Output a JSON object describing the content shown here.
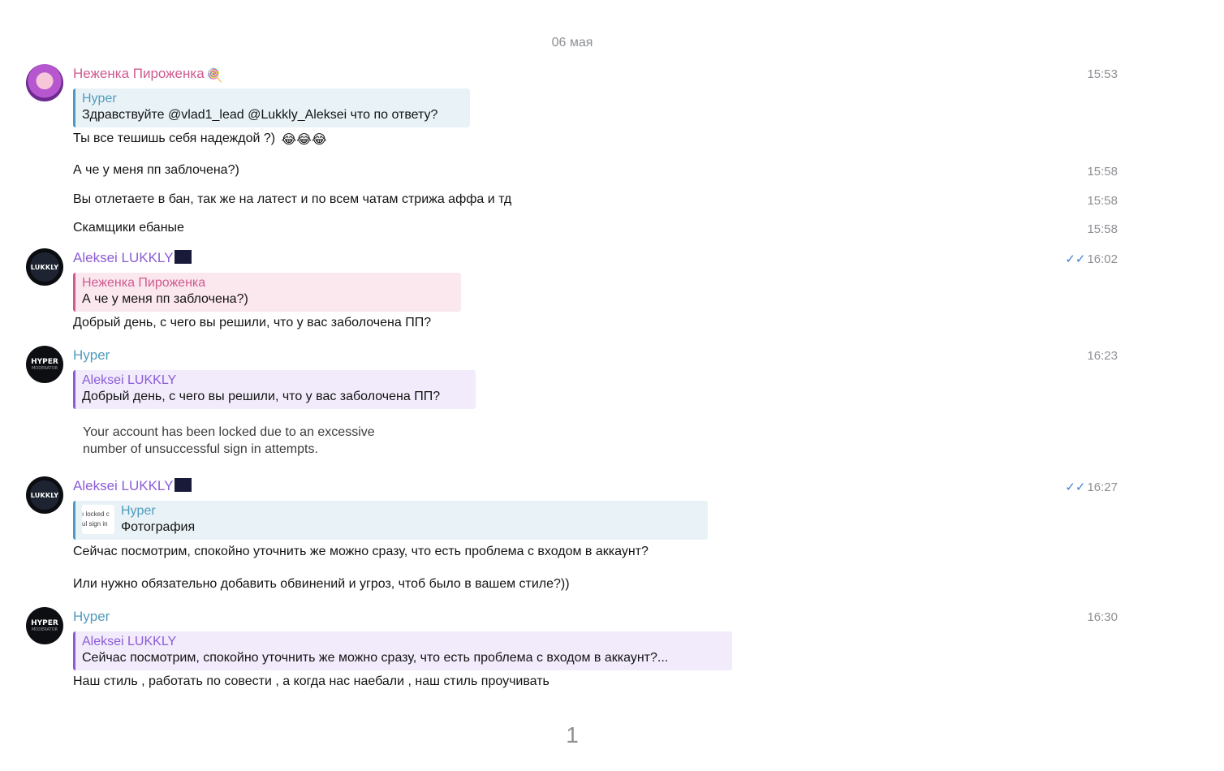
{
  "date_separator": "06 мая",
  "page_number": "1",
  "colors": {
    "sender_pink": "#cf5a8f",
    "sender_purple": "#8b5cd6",
    "sender_blue": "#4f9bbd",
    "read_ticks": "#3f7fd6"
  },
  "messages": [
    {
      "sender": "Неженка Пироженка",
      "sender_emoji": "🍭",
      "time": "15:53",
      "reply_to": {
        "name": "Hyper",
        "text": "Здравствуйте @vlad1_lead @Lukkly_Aleksei  что по ответу?"
      },
      "text": "Ты все тешишь себя надеждой ?)",
      "text_emojis": "😂😂😂"
    },
    {
      "text": "А че у меня пп заблочена?)",
      "time": "15:58"
    },
    {
      "text": "Вы отлетаете в бан, так же на латест и по всем чатам стрижа аффа и тд",
      "time": "15:58"
    },
    {
      "text": "Скамщики ебаные",
      "time": "15:58"
    },
    {
      "sender": "Aleksei LUKKLY",
      "avatar_label": "LUKKLY",
      "time": "16:02",
      "read_ticks": "✓✓",
      "reply_to": {
        "name": "Неженка Пироженка",
        "text": "А че у меня пп заблочена?)"
      },
      "text": "Добрый день, с чего вы решили, что у вас заболочена ПП?"
    },
    {
      "sender": "Hyper",
      "avatar_label": "HYPER",
      "avatar_sub": "MODERATOR",
      "time": "16:23",
      "reply_to": {
        "name": "Aleksei LUKKLY",
        "text": "Добрый день, с чего вы решили, что у вас заболочена ПП?"
      },
      "photo_text": "Your account has been locked due to an excessive number of unsuccessful sign in attempts."
    },
    {
      "sender": "Aleksei LUKKLY",
      "avatar_label": "LUKKLY",
      "time": "16:27",
      "read_ticks": "✓✓",
      "reply_to": {
        "name": "Hyper",
        "text": "Фотография",
        "thumb_line1": "ı locked c",
        "thumb_line2": "ul sign in"
      },
      "text": "Сейчас посмотрим, спокойно уточнить же можно сразу, что есть проблема с входом в аккаунт?",
      "text2": "Или нужно обязательно добавить обвинений и угроз, чтоб было в вашем стиле?))"
    },
    {
      "sender": "Hyper",
      "avatar_label": "HYPER",
      "avatar_sub": "MODERATOR",
      "time": "16:30",
      "reply_to": {
        "name": "Aleksei LUKKLY",
        "text": "Сейчас посмотрим, спокойно уточнить же можно сразу, что есть проблема с входом в аккаунт?..."
      },
      "text": "Наш стиль , работать по совести , а когда нас наебали , наш стиль проучивать"
    }
  ]
}
